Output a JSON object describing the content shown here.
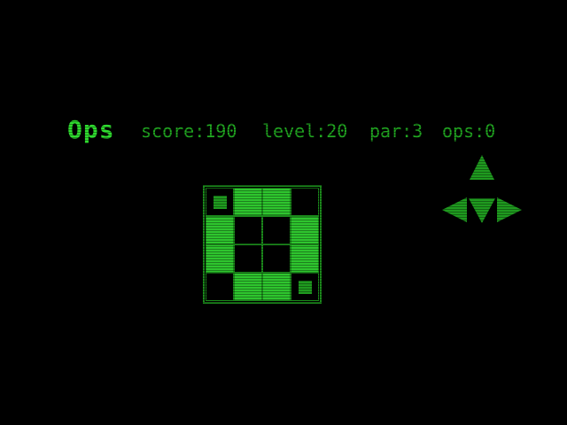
{
  "game": {
    "title": "Ops"
  },
  "stats": {
    "score": "score:190",
    "level": "level:20",
    "par": "par:3",
    "ops": "ops:0"
  },
  "board": {
    "rows": 4,
    "cols": 4,
    "cells": [
      [
        "marker",
        "on",
        "on",
        "off"
      ],
      [
        "on",
        "off",
        "off",
        "on"
      ],
      [
        "on",
        "off",
        "off",
        "on"
      ],
      [
        "off",
        "on",
        "on",
        "marker"
      ]
    ]
  },
  "controls": {
    "up_icon": "arrow-up-icon",
    "down_icon": "arrow-down-icon",
    "left_icon": "arrow-left-icon",
    "right_icon": "arrow-right-icon"
  },
  "colors": {
    "background": "#000000",
    "title": "#2fdc2f",
    "text": "#21a821",
    "cell_on": "#2ec52e",
    "grid_line": "#1b8a1b",
    "marker": "#1f9a1f",
    "arrow": "#1f9a1f"
  }
}
